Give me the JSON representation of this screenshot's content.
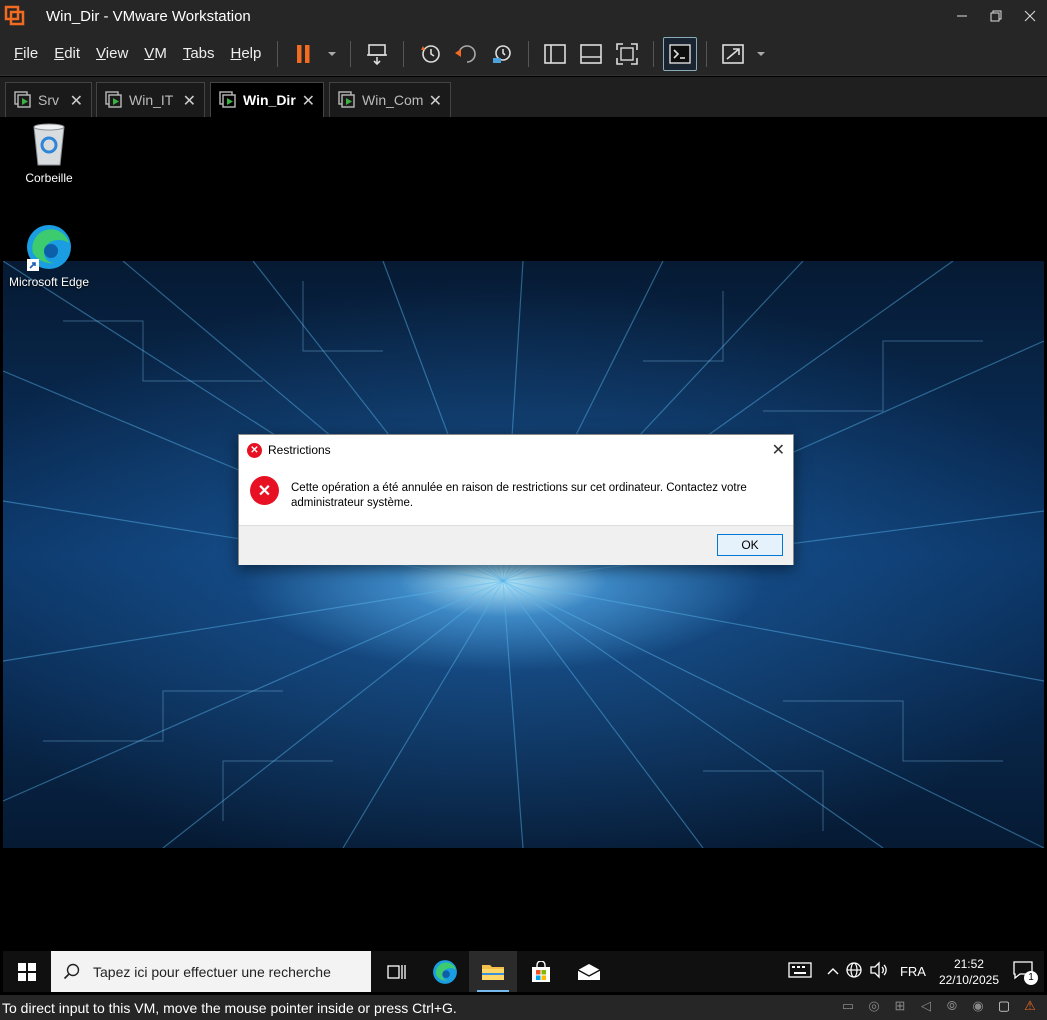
{
  "window": {
    "title": "Win_Dir - VMware Workstation"
  },
  "menu": [
    {
      "key": "F",
      "rest": "ile"
    },
    {
      "key": "E",
      "rest": "dit"
    },
    {
      "key": "V",
      "rest": "iew"
    },
    {
      "key": "V",
      "rest": "M"
    },
    {
      "key": "T",
      "rest": "abs"
    },
    {
      "key": "H",
      "rest": "elp"
    }
  ],
  "tabs": [
    {
      "label": "Srv",
      "active": false
    },
    {
      "label": "Win_IT",
      "active": false
    },
    {
      "label": "Win_Dir",
      "active": true
    },
    {
      "label": "Win_Com",
      "active": false
    }
  ],
  "desktop": {
    "icons": [
      {
        "label": "Corbeille",
        "icon": "recycle-bin-icon"
      },
      {
        "label": "Microsoft Edge",
        "icon": "edge-icon"
      }
    ]
  },
  "dialog": {
    "title": "Restrictions",
    "message": "Cette opération a été annulée en raison de restrictions sur cet ordinateur. Contactez votre administrateur système.",
    "ok_label": "OK"
  },
  "taskbar": {
    "search_placeholder": "Tapez ici pour effectuer une recherche",
    "language": "FRA",
    "time": "21:52",
    "date": "22/10/2025",
    "notification_count": "1"
  },
  "statusbar": {
    "text": "To direct input to this VM, move the mouse pointer inside or press Ctrl+G."
  },
  "colors": {
    "chrome_bg": "#262626",
    "accent_orange": "#f26b21",
    "error_red": "#e81123",
    "taskbar_accent": "#76b9ed"
  }
}
